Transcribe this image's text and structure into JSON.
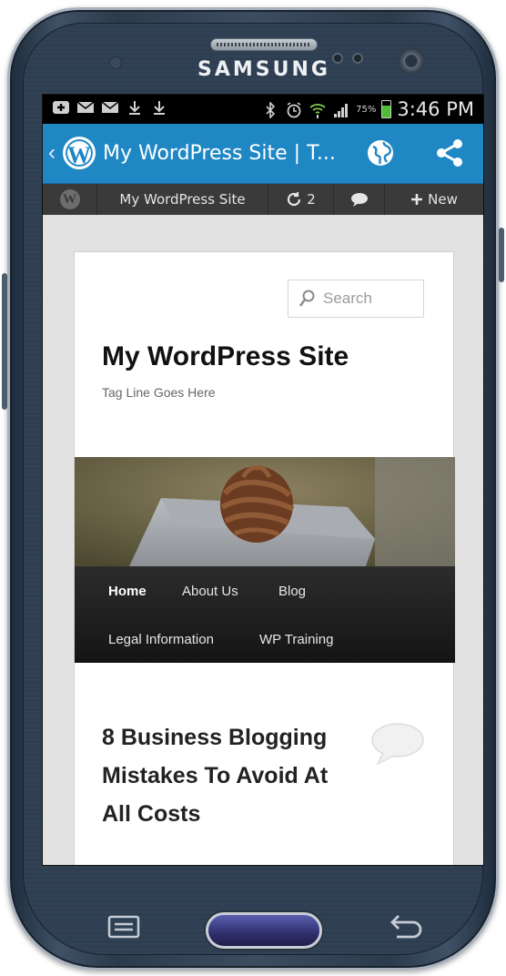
{
  "device": {
    "brand": "SAMSUNG"
  },
  "statusbar": {
    "battery_percent": "75%",
    "battery_level": 0.75,
    "time": "3:46 PM",
    "icons": [
      "add-notification-icon",
      "mail-icon",
      "mail-icon",
      "download-icon",
      "download-icon",
      "bluetooth-icon",
      "alarm-icon",
      "wifi-icon",
      "signal-icon",
      "battery-icon"
    ]
  },
  "appbar": {
    "title": "My WordPress Site | T...",
    "logo_letter": "W",
    "accent_color": "#1f87c4"
  },
  "adminbar": {
    "site_label": "My WordPress Site",
    "updates_count": "2",
    "new_label": "New"
  },
  "site": {
    "search_placeholder": "Search",
    "title": "My WordPress Site",
    "tagline": "Tag Line Goes Here",
    "nav": {
      "home": "Home",
      "about": "About Us",
      "blog": "Blog",
      "legal": "Legal Information",
      "training": "WP Training"
    },
    "post_title": "8 Business Blogging Mistakes To Avoid At All Costs"
  }
}
